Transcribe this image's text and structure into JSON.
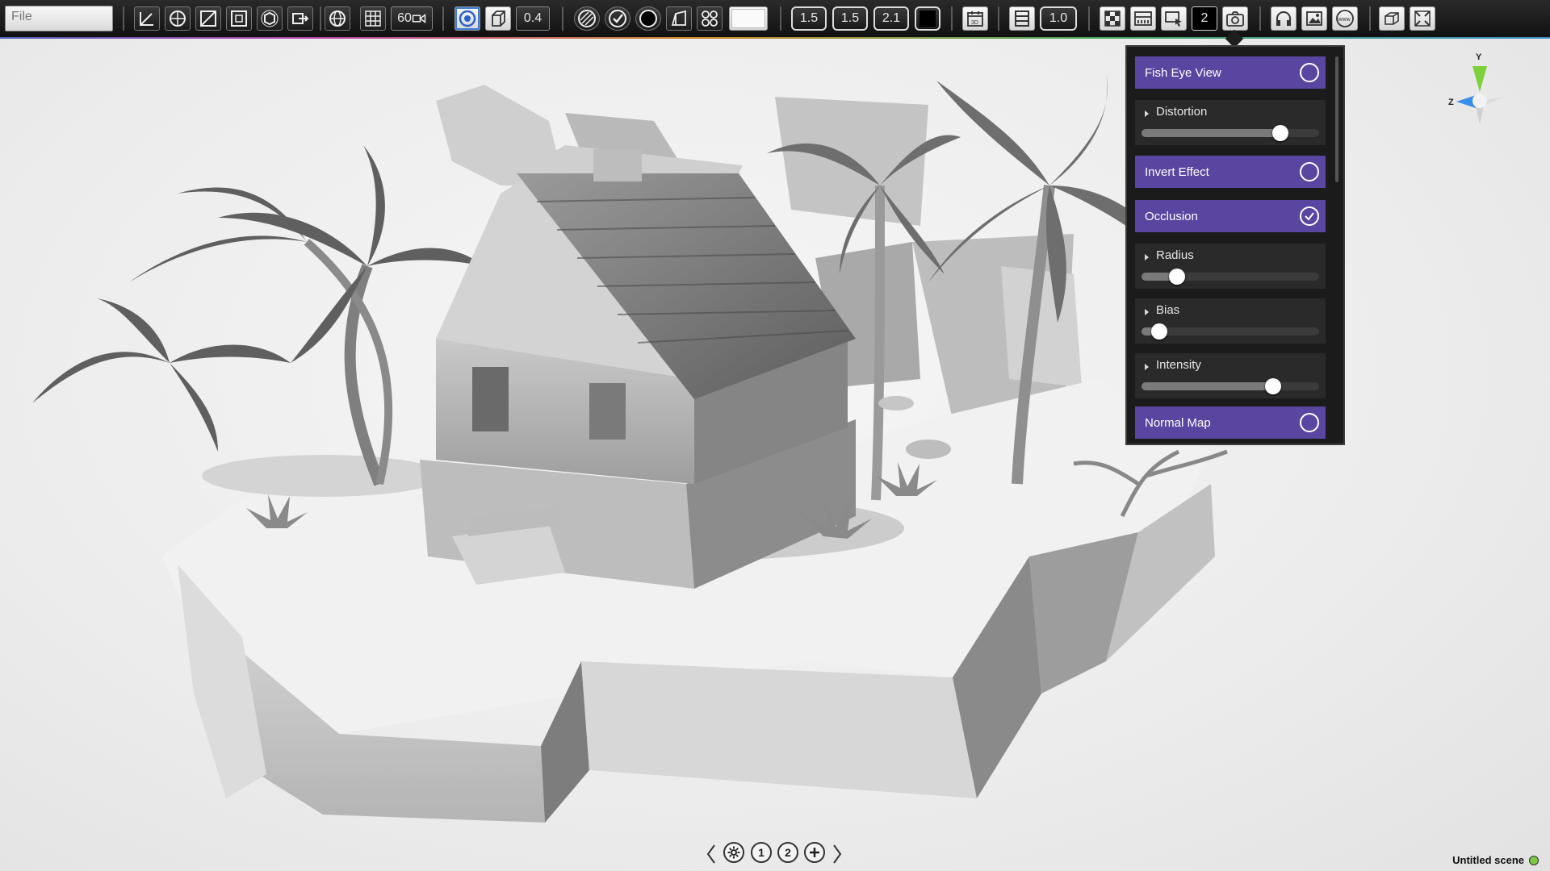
{
  "toolbar": {
    "file_placeholder": "File",
    "fov_label": "60",
    "opacity_value": "0.4",
    "value_a": "1.5",
    "value_b": "1.5",
    "value_c": "2.1",
    "scale_value": "1.0",
    "layer_count": "2",
    "icons": [
      "axis-icon",
      "globe-wire-icon",
      "ramp-icon",
      "cube-frame-icon",
      "cube-rotate-icon",
      "cube-arrow-icon",
      "globe-icon",
      "grid-icon",
      "camera-icon",
      "circle-target-icon",
      "cube-icon",
      "hatch-icon",
      "check-badge-icon",
      "sphere-icon",
      "wedge-icon",
      "nodes-icon",
      "white-swatch",
      "black-swatch",
      "calendar-3d-icon",
      "film-icon",
      "checker-icon",
      "panel-icon",
      "image-cursor-icon",
      "camera-icon",
      "headphones-icon",
      "picture-icon",
      "www-icon",
      "cube-123-icon",
      "expand-icon"
    ]
  },
  "panel": {
    "items": [
      {
        "type": "toggle",
        "label": "Fish Eye View",
        "checked": false
      },
      {
        "type": "slider",
        "label": "Distortion",
        "value": 0.78
      },
      {
        "type": "toggle",
        "label": "Invert Effect",
        "checked": false
      },
      {
        "type": "toggle",
        "label": "Occlusion",
        "checked": true
      },
      {
        "type": "slider",
        "label": "Radius",
        "value": 0.2
      },
      {
        "type": "slider",
        "label": "Bias",
        "value": 0.1
      },
      {
        "type": "slider",
        "label": "Intensity",
        "value": 0.74
      },
      {
        "type": "toggle",
        "label": "Normal Map",
        "checked": false
      }
    ]
  },
  "gizmo": {
    "y_label": "Y",
    "z_label": "Z",
    "y_color": "#7dd13a",
    "z_color": "#3b8ee8"
  },
  "scene_nav": {
    "tab1": "1",
    "tab2": "2"
  },
  "status": {
    "scene_name": "Untitled scene",
    "indicator_color": "#7ac943"
  },
  "colors": {
    "panel_accent": "#5a46a0"
  }
}
